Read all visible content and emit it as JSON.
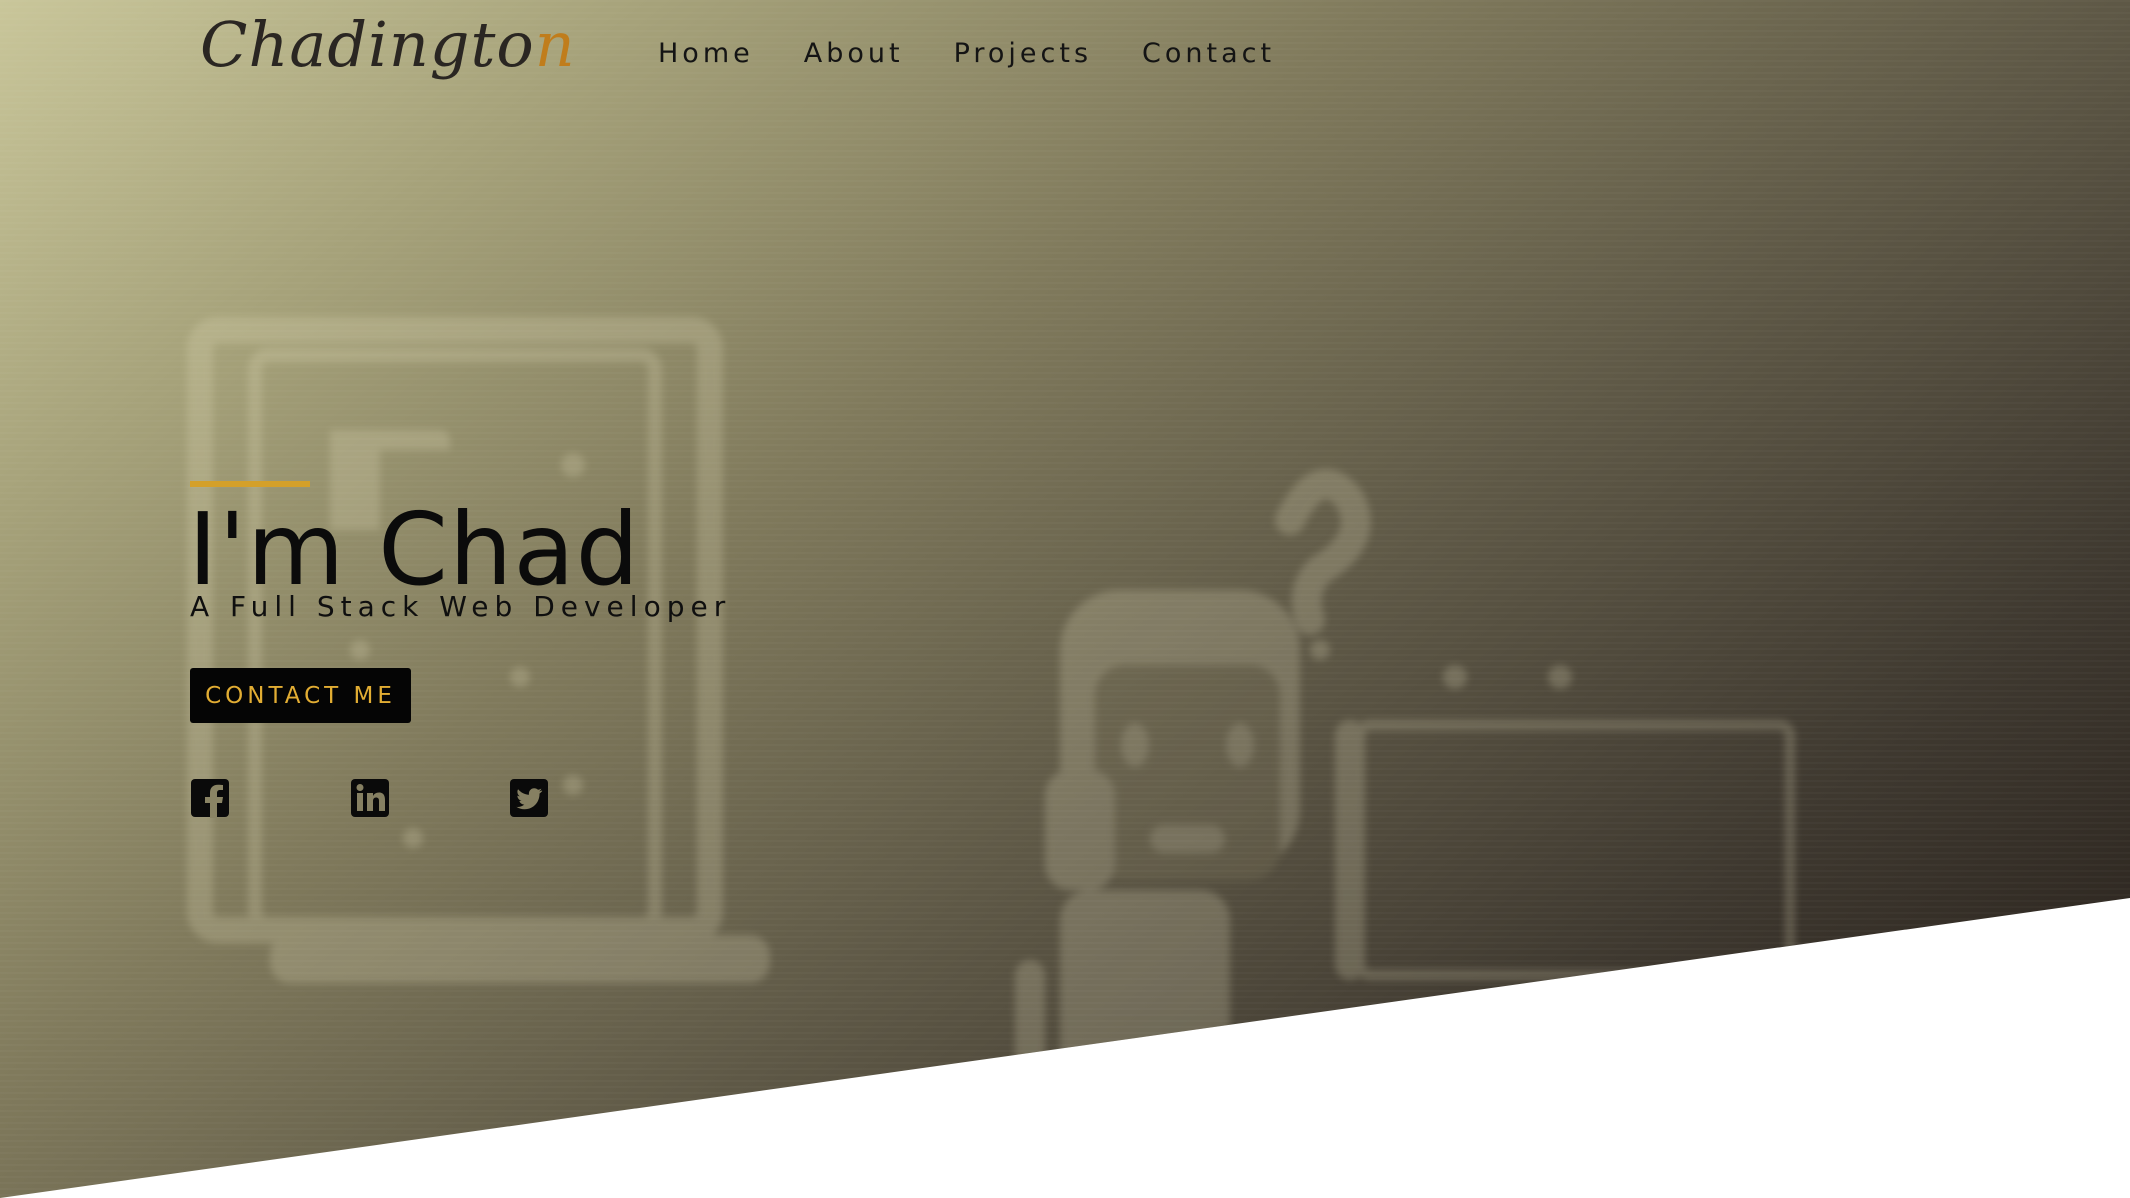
{
  "header": {
    "logo_text_main": "Chadingto",
    "logo_text_accent": "n"
  },
  "nav": {
    "items": [
      {
        "label": "Home"
      },
      {
        "label": "About"
      },
      {
        "label": "Projects"
      },
      {
        "label": "Contact"
      }
    ]
  },
  "hero": {
    "title": "I'm Chad",
    "subtitle": "A Full Stack Web Developer",
    "cta_label": "CONTACT ME",
    "accent_color": "#d4a02a",
    "cta_text_color": "#e2ad33"
  },
  "social": [
    {
      "icon": "facebook-icon"
    },
    {
      "icon": "linkedin-icon"
    },
    {
      "icon": "twitter-icon"
    }
  ]
}
